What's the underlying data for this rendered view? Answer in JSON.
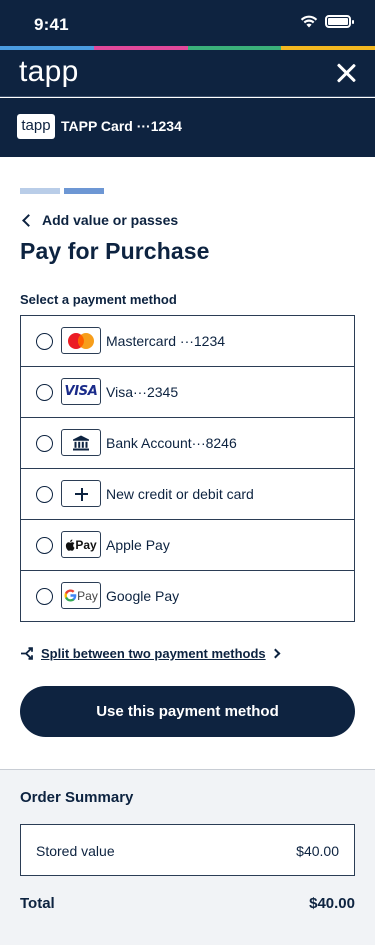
{
  "status_bar": {
    "time": "9:41",
    "wifi_icon": "wifi-icon",
    "battery_icon": "battery-icon"
  },
  "stripe_colors": [
    "#4a9be0",
    "#e0489a",
    "#3ab07a",
    "#f2b720"
  ],
  "header": {
    "brand": "tapp",
    "close_icon": "close-icon"
  },
  "card": {
    "logo_text": "tapp",
    "title": "TAPP Card ···1234"
  },
  "progress": {
    "total_steps": 2,
    "current_step": 2,
    "colors": [
      "#b9cde8",
      "#6d97d4"
    ]
  },
  "back_link": {
    "label": "Add value or passes"
  },
  "page_title": "Pay for Purchase",
  "section_label": "Select a payment method",
  "payment_methods": [
    {
      "label": "Mastercard ···1234",
      "icon": "mastercard-icon",
      "selected": true
    },
    {
      "label": "Visa···2345",
      "icon": "visa-icon",
      "icon_text": "VISA",
      "selected": false
    },
    {
      "label": "Bank Account···8246",
      "icon": "bank-icon",
      "selected": false
    },
    {
      "label": "New credit or debit card",
      "icon": "plus-icon",
      "selected": false
    },
    {
      "label": "Apple Pay",
      "icon": "apple-pay-icon",
      "icon_text": "Pay",
      "selected": false
    },
    {
      "label": "Google Pay",
      "icon": "google-pay-icon",
      "icon_text": "Pay",
      "selected": false
    }
  ],
  "split_link": {
    "label": "Split between two payment methods",
    "icon": "split-icon"
  },
  "primary_button": {
    "label": "Use this payment method"
  },
  "order_summary": {
    "title": "Order Summary",
    "items": [
      {
        "label": "Stored value",
        "amount": "$40.00"
      }
    ],
    "total_label": "Total",
    "total_amount": "$40.00"
  },
  "colors": {
    "navy": "#0e2340",
    "selected_bg": "#dbe7f6",
    "summary_bg": "#f1f3f6"
  }
}
